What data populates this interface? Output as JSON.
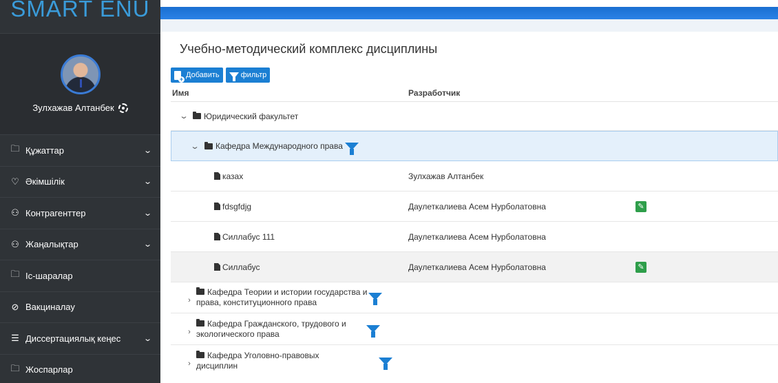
{
  "brand": "SMART ENU",
  "user": {
    "name": "Зулхажав Алтанбек"
  },
  "nav": [
    {
      "icon": "folder-outline-icon",
      "glyph": "🗀",
      "label": "Құжаттар",
      "chevron": true
    },
    {
      "icon": "shield-icon",
      "glyph": "♡",
      "label": "Әкімшілік",
      "chevron": true
    },
    {
      "icon": "users-icon",
      "glyph": "⚇",
      "label": "Контрагенттер",
      "chevron": true
    },
    {
      "icon": "users-icon",
      "glyph": "⚇",
      "label": "Жаңалықтар",
      "chevron": true
    },
    {
      "icon": "folder-outline-icon",
      "glyph": "🗀",
      "label": "Іс-шаралар",
      "chevron": false
    },
    {
      "icon": "check-circle-icon",
      "glyph": "⊘",
      "label": "Вакциналау",
      "chevron": false
    },
    {
      "icon": "list-icon",
      "glyph": "☰",
      "label": "Диссертациялық кеңес",
      "chevron": true
    },
    {
      "icon": "folder-outline-icon",
      "glyph": "🗀",
      "label": "Жоспарлар",
      "chevron": false
    }
  ],
  "page": {
    "title": "Учебно-методический комплекс дисциплины",
    "add_label": "Добавить",
    "filter_label": "фильтр"
  },
  "table": {
    "columns": [
      "Имя",
      "Разработчик"
    ],
    "faculty": "Юридический факультет",
    "dept_open": "Кафедра Международного права",
    "files": [
      {
        "name": "казах",
        "developer": "Зулхажав Алтанбек",
        "editable": false
      },
      {
        "name": "fdsgfdjg",
        "developer": "Даулеткалиева Асем Нурболатовна",
        "editable": true
      },
      {
        "name": "Силлабус 111",
        "developer": "Даулеткалиева Асем Нурболатовна",
        "editable": false
      },
      {
        "name": "Силлабус",
        "developer": "Даулеткалиева Асем Нурболатовна",
        "editable": true
      }
    ],
    "depts_closed": [
      {
        "line1": "Кафедра Теории и истории государства и",
        "line2": "права, конституционного права"
      },
      {
        "line1": "Кафедра Гражданского, трудового и",
        "line2": "экологического права"
      },
      {
        "line1": "Кафедра Уголовно-правовых",
        "line2": "дисциплин"
      }
    ]
  },
  "colors": {
    "accent": "#1b7fd3",
    "sidebar": "#2f3337",
    "edit": "#2e9e4a"
  }
}
